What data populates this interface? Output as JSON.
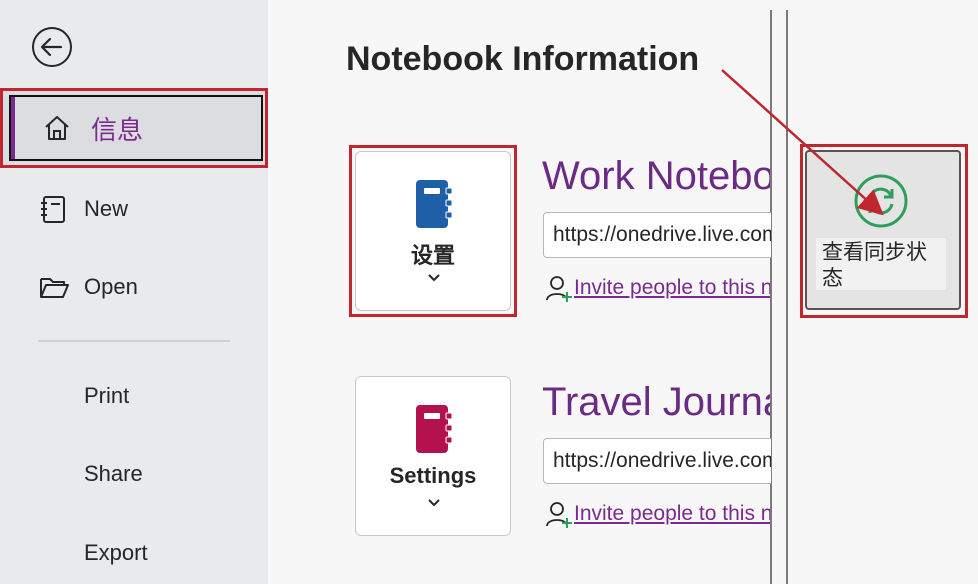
{
  "sidebar": {
    "items": [
      {
        "label": "信息",
        "icon": "home-icon",
        "selected": true
      },
      {
        "label": "New",
        "icon": "new-page-icon"
      },
      {
        "label": "Open",
        "icon": "folder-open-icon"
      },
      {
        "label": "Print"
      },
      {
        "label": "Share"
      },
      {
        "label": "Export"
      }
    ]
  },
  "main": {
    "title": "Notebook Information",
    "notebooks": [
      {
        "name": "Work Notebook",
        "settings_label": "设置",
        "url": "https://onedrive.live.com",
        "invite": "Invite people to this notebook",
        "icon_color": "#1f5fa8"
      },
      {
        "name": "Travel Journal",
        "settings_label": "Settings",
        "url": "https://onedrive.live.com",
        "invite": "Invite people to this notebook",
        "icon_color": "#b3124f"
      }
    ]
  },
  "sync": {
    "label": "查看同步状态",
    "icon": "sync-icon"
  },
  "colors": {
    "accent": "#7b2b8f",
    "highlight": "#c0262d",
    "sync_green": "#2e9e5b"
  }
}
